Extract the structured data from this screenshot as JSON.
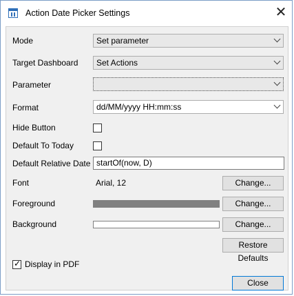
{
  "window": {
    "title": "Action Date Picker Settings",
    "icon": "app-settings-icon",
    "close_glyph": "✕"
  },
  "form": {
    "mode": {
      "label": "Mode",
      "value": "Set parameter"
    },
    "target_dashboard": {
      "label": "Target Dashboard",
      "value": "Set Actions"
    },
    "parameter": {
      "label": "Parameter",
      "value": ""
    },
    "format": {
      "label": "Format",
      "value": "dd/MM/yyyy HH:mm:ss"
    },
    "hide_button": {
      "label": "Hide Button",
      "checked": false
    },
    "default_to_today": {
      "label": "Default To Today",
      "checked": false
    },
    "default_relative_date": {
      "label": "Default Relative Date",
      "value": "startOf(now, D)"
    },
    "font": {
      "label": "Font",
      "value": "Arial, 12",
      "button": "Change..."
    },
    "foreground": {
      "label": "Foreground",
      "color": "#808080",
      "button": "Change..."
    },
    "background": {
      "label": "Background",
      "color": "#ffffff",
      "button": "Change..."
    },
    "restore_defaults": "Restore Defaults",
    "display_in_pdf": {
      "label": "Display in PDF",
      "checked": true,
      "checkmark": "✓"
    }
  },
  "footer": {
    "close_label": "Close"
  }
}
